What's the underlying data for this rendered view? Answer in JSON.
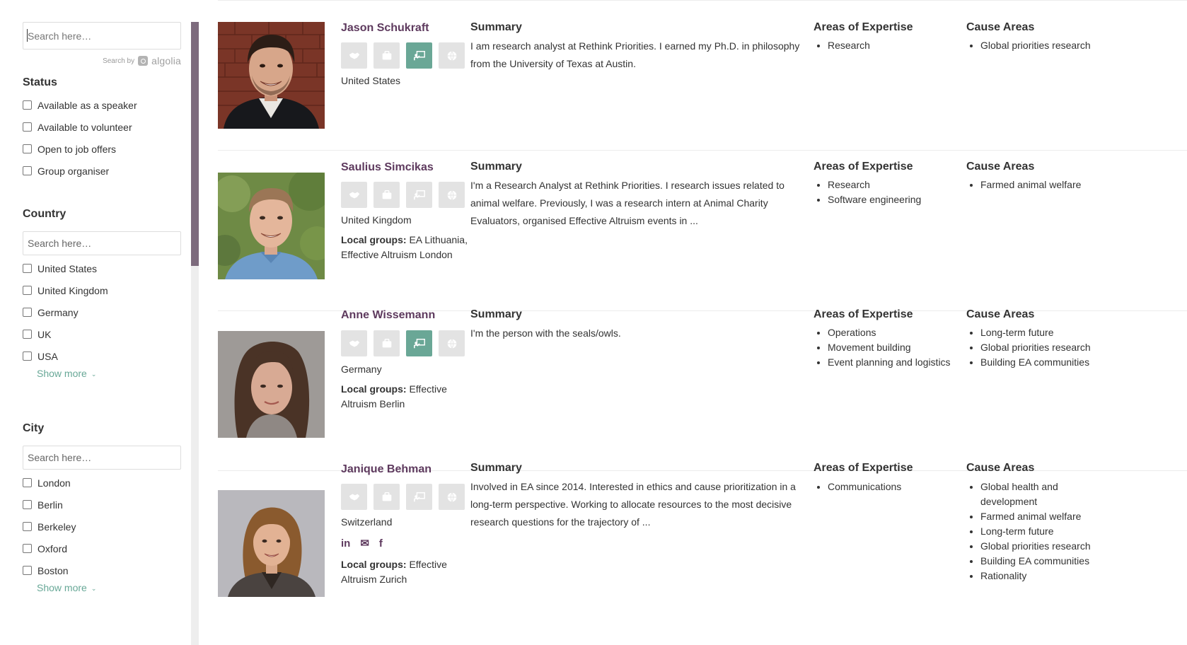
{
  "sidebar": {
    "search_placeholder": "Search here…",
    "search_by": "Search by",
    "algolia": "algolia",
    "status": {
      "title": "Status",
      "items": [
        "Available as a speaker",
        "Available to volunteer",
        "Open to job offers",
        "Group organiser"
      ]
    },
    "country": {
      "title": "Country",
      "search_placeholder": "Search here…",
      "items": [
        "United States",
        "United Kingdom",
        "Germany",
        "UK",
        "USA"
      ],
      "show_more": "Show more"
    },
    "city": {
      "title": "City",
      "search_placeholder": "Search here…",
      "items": [
        "London",
        "Berlin",
        "Berkeley",
        "Oxford",
        "Boston"
      ],
      "show_more": "Show more"
    }
  },
  "labels": {
    "summary": "Summary",
    "expertise": "Areas of Expertise",
    "causes": "Cause Areas",
    "local_groups": "Local groups:"
  },
  "colors": {
    "accent_purple": "#5e3a5e",
    "badge_active": "#6aa796",
    "badge_inactive": "#e3e3e3",
    "show_more": "#68a897"
  },
  "badge_icons": [
    "handshake-icon",
    "briefcase-icon",
    "presenter-icon",
    "globe-icon"
  ],
  "people": [
    {
      "name": "Jason Schukraft",
      "badges_active": [
        false,
        false,
        true,
        false
      ],
      "country": "United States",
      "summary": "I am research analyst at Rethink Priorities. I earned my Ph.D. in philosophy from the University of Texas at Austin.",
      "expertise": [
        "Research"
      ],
      "causes": [
        "Global priorities research"
      ]
    },
    {
      "name": "Saulius Simcikas",
      "badges_active": [
        false,
        false,
        false,
        false
      ],
      "country": "United Kingdom",
      "local_groups": "EA Lithuania, Effective Altruism London",
      "summary": "I'm a Research Analyst at Rethink Priorities. I research issues related to animal welfare. Previously, I was a research intern at Animal Charity Evaluators, organised Effective Altruism events in ...",
      "expertise": [
        "Research",
        "Software engineering"
      ],
      "causes": [
        "Farmed animal welfare"
      ]
    },
    {
      "name": "Anne Wissemann",
      "badges_active": [
        false,
        false,
        true,
        false
      ],
      "country": "Germany",
      "local_groups": "Effective Altruism Berlin",
      "summary": "I'm the person with the seals/owls.",
      "expertise": [
        "Operations",
        "Movement building",
        "Event planning and logistics"
      ],
      "causes": [
        "Long-term future",
        "Global priorities research",
        "Building EA communities"
      ]
    },
    {
      "name": "Janique Behman",
      "badges_active": [
        false,
        false,
        false,
        false
      ],
      "country": "Switzerland",
      "social": [
        "in",
        "✉",
        "f"
      ],
      "local_groups": "Effective Altruism Zurich",
      "summary": "Involved in EA since 2014. Interested in ethics and cause prioritization in a long-term perspective. Working to allocate resources to the most decisive research questions for the trajectory of ...",
      "expertise": [
        "Communications"
      ],
      "causes": [
        "Global health and development",
        "Farmed animal welfare",
        "Long-term future",
        "Global priorities research",
        "Building EA communities",
        "Rationality"
      ]
    }
  ]
}
